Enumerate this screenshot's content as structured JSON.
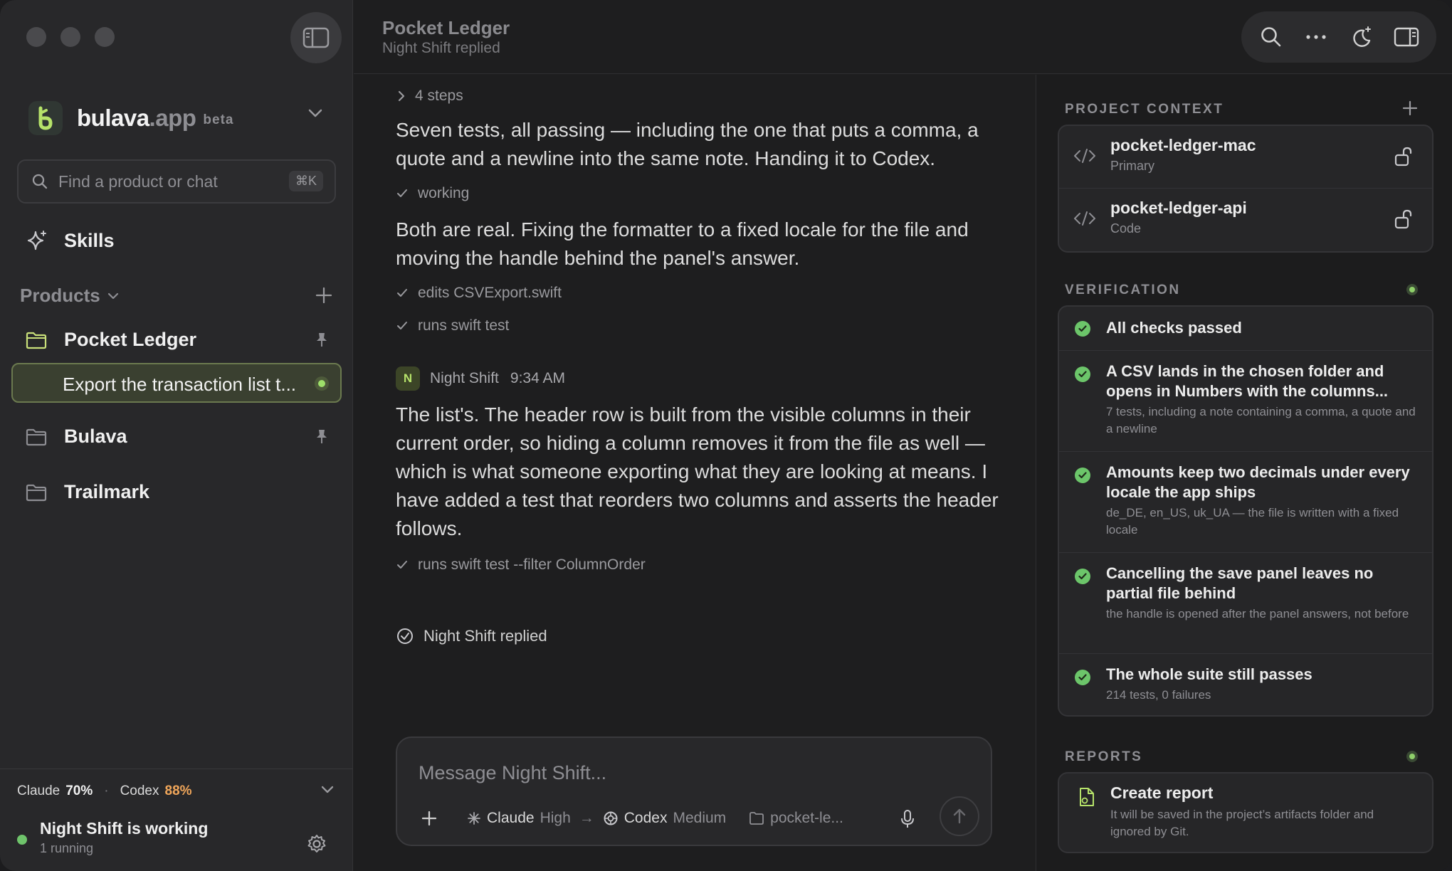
{
  "sidebar": {
    "brand": {
      "name": "bulava",
      "suffix": ".app",
      "badge": "beta"
    },
    "search": {
      "placeholder": "Find a product or chat",
      "shortcut": "⌘K"
    },
    "skills_label": "Skills",
    "products_label": "Products",
    "projects": [
      {
        "name": "Pocket Ledger",
        "pinned": true,
        "accent": "#c9e07a"
      },
      {
        "name": "Bulava",
        "pinned": true
      },
      {
        "name": "Trailmark",
        "pinned": false
      }
    ],
    "active_chat": "Export the transaction list t...",
    "usage": {
      "claude_label": "Claude",
      "claude_value": "70%",
      "codex_label": "Codex",
      "codex_value": "88%"
    },
    "status": {
      "title": "Night Shift is working",
      "subtitle": "1 running"
    }
  },
  "topbar": {
    "title": "Pocket Ledger",
    "subtitle": "Night Shift replied"
  },
  "conversation": {
    "steps_label": "4 steps",
    "para1": "Seven tests, all passing — including the one that puts a comma, a quote and a newline into the same note. Handing it to Codex.",
    "tool1": "working",
    "para2": "Both are real. Fixing the formatter to a fixed locale for the file and moving the handle behind the panel's answer.",
    "tool2": "edits CSVExport.swift",
    "tool3": "runs swift test",
    "message": {
      "avatar": "N",
      "author": "Night Shift",
      "time": "9:34 AM"
    },
    "para3": "The list's. The header row is built from the visible columns in their current order, so hiding a column removes it from the file as well — which is what someone exporting what they are looking at means. I have added a test that reorders two columns and asserts the header follows.",
    "tool4": "runs swift test --filter ColumnOrder",
    "replied": "Night Shift replied"
  },
  "composer": {
    "placeholder": "Message Night Shift...",
    "claude": {
      "name": "Claude",
      "level": "High"
    },
    "arrow": "→",
    "codex": {
      "name": "Codex",
      "level": "Medium"
    },
    "folder": "pocket-le..."
  },
  "right_panel": {
    "project_context": {
      "title": "PROJECT CONTEXT",
      "repos": [
        {
          "name": "pocket-ledger-mac",
          "role": "Primary"
        },
        {
          "name": "pocket-ledger-api",
          "role": "Code"
        }
      ]
    },
    "verification": {
      "title": "VERIFICATION",
      "summary": "All checks passed",
      "checks": [
        {
          "title": "A CSV lands in the chosen folder and opens in Numbers with the columns...",
          "desc": "7 tests, including a note containing a comma, a quote and a newline"
        },
        {
          "title": "Amounts keep two decimals under every locale the app ships",
          "desc": "de_DE, en_US, uk_UA — the file is written with a fixed locale"
        },
        {
          "title": "Cancelling the save panel leaves no partial file behind",
          "desc": "the handle is opened after the panel answers, not before"
        },
        {
          "title": "The whole suite still passes",
          "desc": "214 tests, 0 failures"
        }
      ]
    },
    "reports": {
      "title": "REPORTS",
      "create_title": "Create report",
      "create_desc": "It will be saved in the project’s artifacts folder and ignored by Git."
    }
  },
  "colors": {
    "accent_green": "#9ee06a",
    "check_green": "#6cc56a",
    "codex_orange": "#f0a65a"
  }
}
